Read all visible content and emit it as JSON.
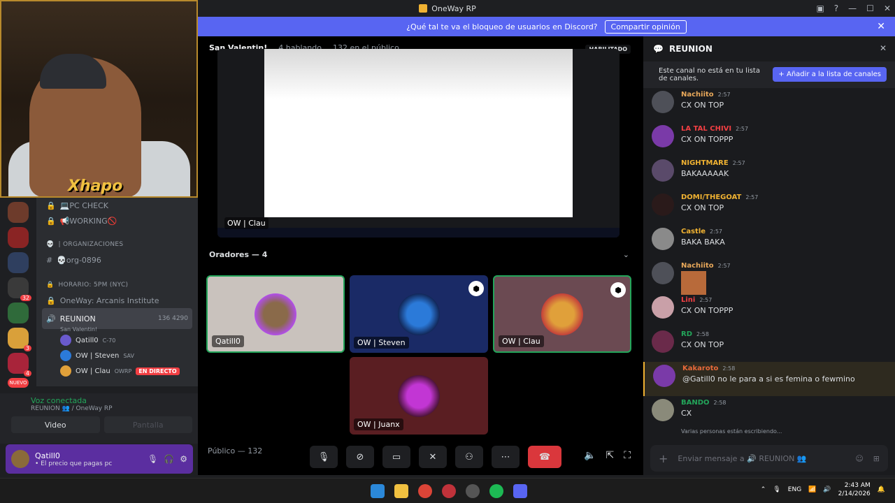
{
  "window": {
    "title": "OneWay RP",
    "help_icon": "?",
    "min_icon": "—",
    "max_icon": "☐",
    "close_icon": "✕"
  },
  "banner": {
    "text": "¿Qué tal te va el bloqueo de usuarios en Discord?",
    "button": "Compartir opinión"
  },
  "webcam": {
    "brand": "Xhapo"
  },
  "servers": {
    "badges": [
      "32",
      "3",
      "4"
    ],
    "new_label": "NUEVO"
  },
  "channels": {
    "items": [
      {
        "label": "💻PC CHECK"
      },
      {
        "label": "📢WORKING🚫"
      },
      {
        "label": "| ORGANIZACIONES",
        "category": true
      },
      {
        "label": "💀org-0896"
      },
      {
        "label": "HORARIO: 5PM (NYC)",
        "category": true
      },
      {
        "label": "OneWay: Arcanis Institute"
      }
    ],
    "active": {
      "name": "REUNION",
      "count1": "136",
      "count2": "4290",
      "sub": "San Valentin!"
    },
    "voice_users": [
      {
        "name": "Qatill0",
        "tag": "C-70"
      },
      {
        "name": "OW | Steven",
        "tag": "SAV"
      },
      {
        "name": "OW | Clau",
        "tag": "OWRP",
        "live": "EN DIRECTO"
      }
    ]
  },
  "voicepanel": {
    "status": "Voz conectada",
    "sub": "REUNION 👥 / OneWay RP",
    "video": "Video",
    "screen": "Pantalla"
  },
  "user": {
    "name": "Qatill0",
    "status": "• El precio que pagas pc"
  },
  "stage": {
    "title": "San Valentin!",
    "speaking": "4 hablando",
    "audience": "132 en el público",
    "enabled": "HABILITADO",
    "share_label": "OW | Clau",
    "speakers_head": "Oradores — 4",
    "tiles": [
      {
        "label": "Qatill0",
        "color": "#c9c2bd",
        "ring": "#b14ee8"
      },
      {
        "label": "OW | Steven",
        "color": "#1a2a66",
        "ring": "#2b7ad9"
      },
      {
        "label": "OW | Clau",
        "color": "#6b4a52",
        "ring": "#e0a03a"
      },
      {
        "label": "OW | Juanx",
        "color": "#5a1e22",
        "ring": "#c236d4"
      }
    ],
    "publico": "Público — 132"
  },
  "chat": {
    "channel": "REUNION",
    "notice": "Este canal no está en tu lista de canales.",
    "add_button": "+ Añadir a la lista de canales",
    "messages": [
      {
        "name": "Nachiito",
        "time": "2:57",
        "text": "CX ON TOP",
        "color": "#e8a85a"
      },
      {
        "name": "LA TAL CHIVI",
        "time": "2:57",
        "text": "CX ON TOPPP",
        "color": "#f23f43"
      },
      {
        "name": "NIGHTMARE",
        "time": "2:57",
        "text": "BAKAAAAAK",
        "color": "#f0b232"
      },
      {
        "name": "DOMI/THEGOAT",
        "time": "2:57",
        "text": "CX ON TOP",
        "color": "#f0b232"
      },
      {
        "name": "Castle",
        "time": "2:57",
        "text": "BAKA BAKA",
        "color": "#f0b232"
      },
      {
        "name": "Nachiito",
        "time": "2:57",
        "text": "",
        "color": "#e8a85a"
      },
      {
        "name": "Lini",
        "time": "2:57",
        "text": "CX ON TOPPP",
        "color": "#f23f43"
      },
      {
        "name": "RD",
        "time": "2:58",
        "text": "CX ON TOP",
        "color": "#23a55a"
      },
      {
        "name": "Kakaroto",
        "time": "2:58",
        "text": "@Gatill0 no le para a si es femina o fewmino",
        "color": "#e86a3a"
      },
      {
        "name": "BANDO",
        "time": "2:58",
        "text": "CX",
        "color": "#23a55a"
      }
    ],
    "typing": "Varias personas están escribiendo...",
    "input_placeholder": "Enviar mensaje a 🔊 REUNION 👥"
  },
  "taskbar": {
    "lang": "ENG",
    "time": "2:43 AM",
    "date": "2/14/2026"
  }
}
